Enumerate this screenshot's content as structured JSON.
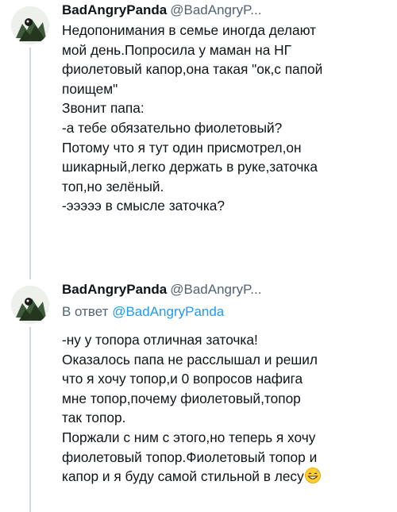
{
  "tweets": [
    {
      "author": {
        "name": "BadAngryPanda",
        "handle": "@BadAngryP..."
      },
      "lines": [
        "Недопонимания в семье иногда делают",
        "мой день.Попросила у маман на НГ",
        "фиолетовый капор,она такая \"ок,с папой",
        "поищем\"",
        "Звонит папа:",
        "-а тебе обязательно фиолетовый?",
        "Потому что я тут один присмотрел,он",
        "шикарный,легко держать в руке,заточка",
        "топ,но зелёный.",
        "-эээээ в смысле заточка?"
      ]
    },
    {
      "author": {
        "name": "BadAngryPanda",
        "handle": "@BadAngryP..."
      },
      "reply_prefix": "В ответ",
      "reply_mention": "@BadAngryPanda",
      "lines": [
        "-ну у топора отличная заточка!",
        "Оказалось папа не расслышал и решил",
        "что я хочу топор,и 0 вопросов нафига",
        "мне топор,почему фиолетовый,топор",
        "так топор.",
        "Поржали с ним с этого,но теперь я хочу",
        "фиолетовый топор.Фиолетовый топор и",
        "капор и я буду самой стильной в лесу"
      ],
      "trailing_emoji": "grinning-sweat-emoji"
    }
  ]
}
